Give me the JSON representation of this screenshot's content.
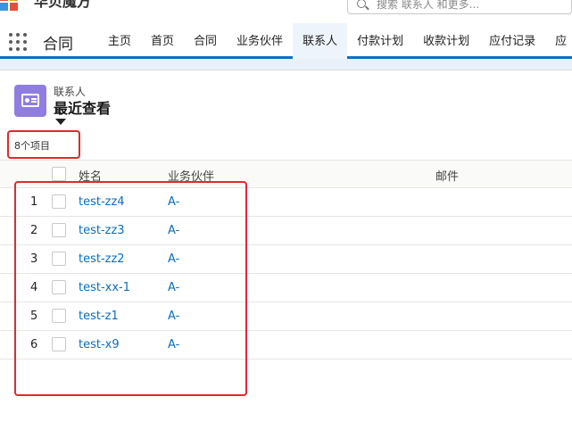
{
  "brand": {
    "name": "华贝魔方"
  },
  "search": {
    "placeholder": "搜索 联系人 和更多..."
  },
  "nav": {
    "app_name": "合同",
    "tabs": [
      {
        "label": "主页"
      },
      {
        "label": "首页"
      },
      {
        "label": "合同"
      },
      {
        "label": "业务伙伴"
      },
      {
        "label": "联系人",
        "active": true
      },
      {
        "label": "付款计划"
      },
      {
        "label": "收款计划"
      },
      {
        "label": "应付记录"
      },
      {
        "label": "应"
      }
    ]
  },
  "list": {
    "object_label": "联系人",
    "title": "最近查看",
    "item_count": "8个项目",
    "columns": {
      "name": "姓名",
      "partner": "业务伙伴",
      "email": "邮件"
    },
    "rows": [
      {
        "num": "1",
        "name": "test-zz4",
        "partner": "A-"
      },
      {
        "num": "2",
        "name": "test-zz3",
        "partner": "A-"
      },
      {
        "num": "3",
        "name": "test-zz2",
        "partner": "A-"
      },
      {
        "num": "4",
        "name": "test-xx-1",
        "partner": "A-"
      },
      {
        "num": "5",
        "name": "test-z1",
        "partner": "A-"
      },
      {
        "num": "6",
        "name": "test-x9",
        "partner": "A-"
      }
    ]
  },
  "colors": {
    "accent": "#0a70c4",
    "link": "#0b6cbf",
    "highlight": "#e2292b",
    "contact_icon_bg": "#8f7ee0"
  }
}
